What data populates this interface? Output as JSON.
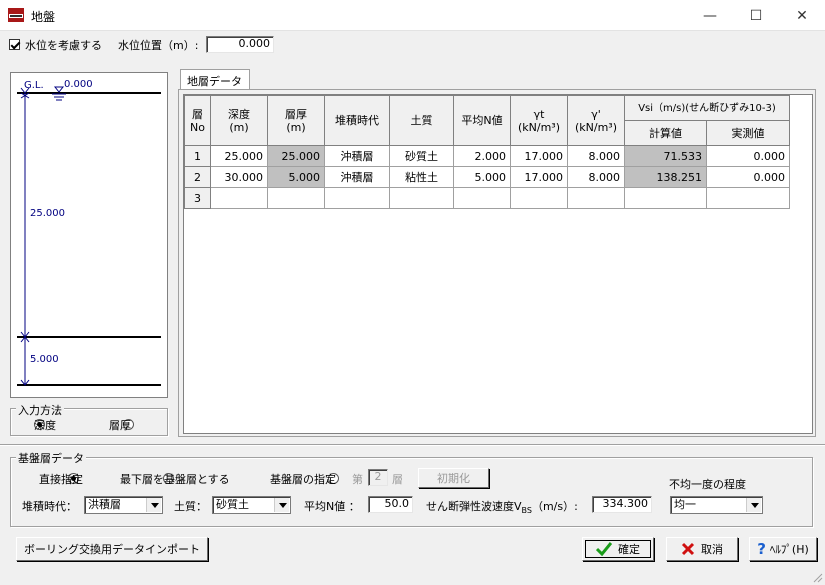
{
  "window": {
    "title": "地盤",
    "minimize": "—",
    "maximize": "☐",
    "close": "✕"
  },
  "water": {
    "label": "水位を考慮する",
    "checked": true,
    "position_label": "水位位置（m）:",
    "position_value": "0.000"
  },
  "profile": {
    "gl_label": "G.L.",
    "water_label": "0.000",
    "layer1_thickness": "25.000",
    "layer2_thickness": "5.000"
  },
  "input_method": {
    "title": "入力方法",
    "options": [
      "深度",
      "層厚"
    ],
    "selected": 0
  },
  "tab": {
    "label": "地層データ"
  },
  "grid": {
    "headers": {
      "no": [
        "層",
        "No"
      ],
      "depth": [
        "深度",
        "(m)"
      ],
      "thickness": [
        "層厚",
        "(m)"
      ],
      "era": "堆積時代",
      "soil": "土質",
      "n_avg": "平均N値",
      "gamma_t": [
        "γt",
        "(kN/m³)"
      ],
      "gamma_p": [
        "γ'",
        "(kN/m³)"
      ],
      "vsi": "Vsi（m/s)(せん断ひずみ10-3)",
      "calc": "計算値",
      "measured": "実測値"
    },
    "rows": [
      {
        "no": "1",
        "depth": "25.000",
        "thickness": "25.000",
        "era": "沖積層",
        "soil": "砂質土",
        "n": "2.000",
        "gt": "17.000",
        "gp": "8.000",
        "calc": "71.533",
        "measured": "0.000"
      },
      {
        "no": "2",
        "depth": "30.000",
        "thickness": "5.000",
        "era": "沖積層",
        "soil": "粘性土",
        "n": "5.000",
        "gt": "17.000",
        "gp": "8.000",
        "calc": "138.251",
        "measured": "0.000"
      },
      {
        "no": "3",
        "depth": "",
        "thickness": "",
        "era": "",
        "soil": "",
        "n": "",
        "gt": "",
        "gp": "",
        "calc": "",
        "measured": ""
      }
    ]
  },
  "base": {
    "title": "基盤層データ",
    "options": [
      "直接指定",
      "最下層を基盤層とする",
      "基盤層の指定"
    ],
    "selected": 0,
    "layer_prefix": "第",
    "layer_value": "2",
    "layer_suffix": "層",
    "init_button": "初期化",
    "era_label": "堆積時代：",
    "era_value": "洪積層",
    "soil_label": "土質：",
    "soil_value": "砂質土",
    "n_label": "平均N値 ：",
    "n_value": "50.0",
    "vs_label": "せん断弾性波速度V",
    "vs_sub": "BS",
    "vs_unit": "（m/s）:",
    "vs_value": "334.300",
    "unevenness_label": "不均一度の程度",
    "unevenness_value": "均一"
  },
  "footer": {
    "import_button": "ボーリング交換用データインポート",
    "ok_button": "確定",
    "cancel_button": "取消",
    "help_button": "ﾍﾙﾌﾟ(H)"
  },
  "colors": {
    "gray_cell": "#c0c0c0",
    "ok_check": "#1a9c1a",
    "cancel_x": "#d01010",
    "help_q": "#1a5fcf",
    "profile_line": "#000080"
  }
}
